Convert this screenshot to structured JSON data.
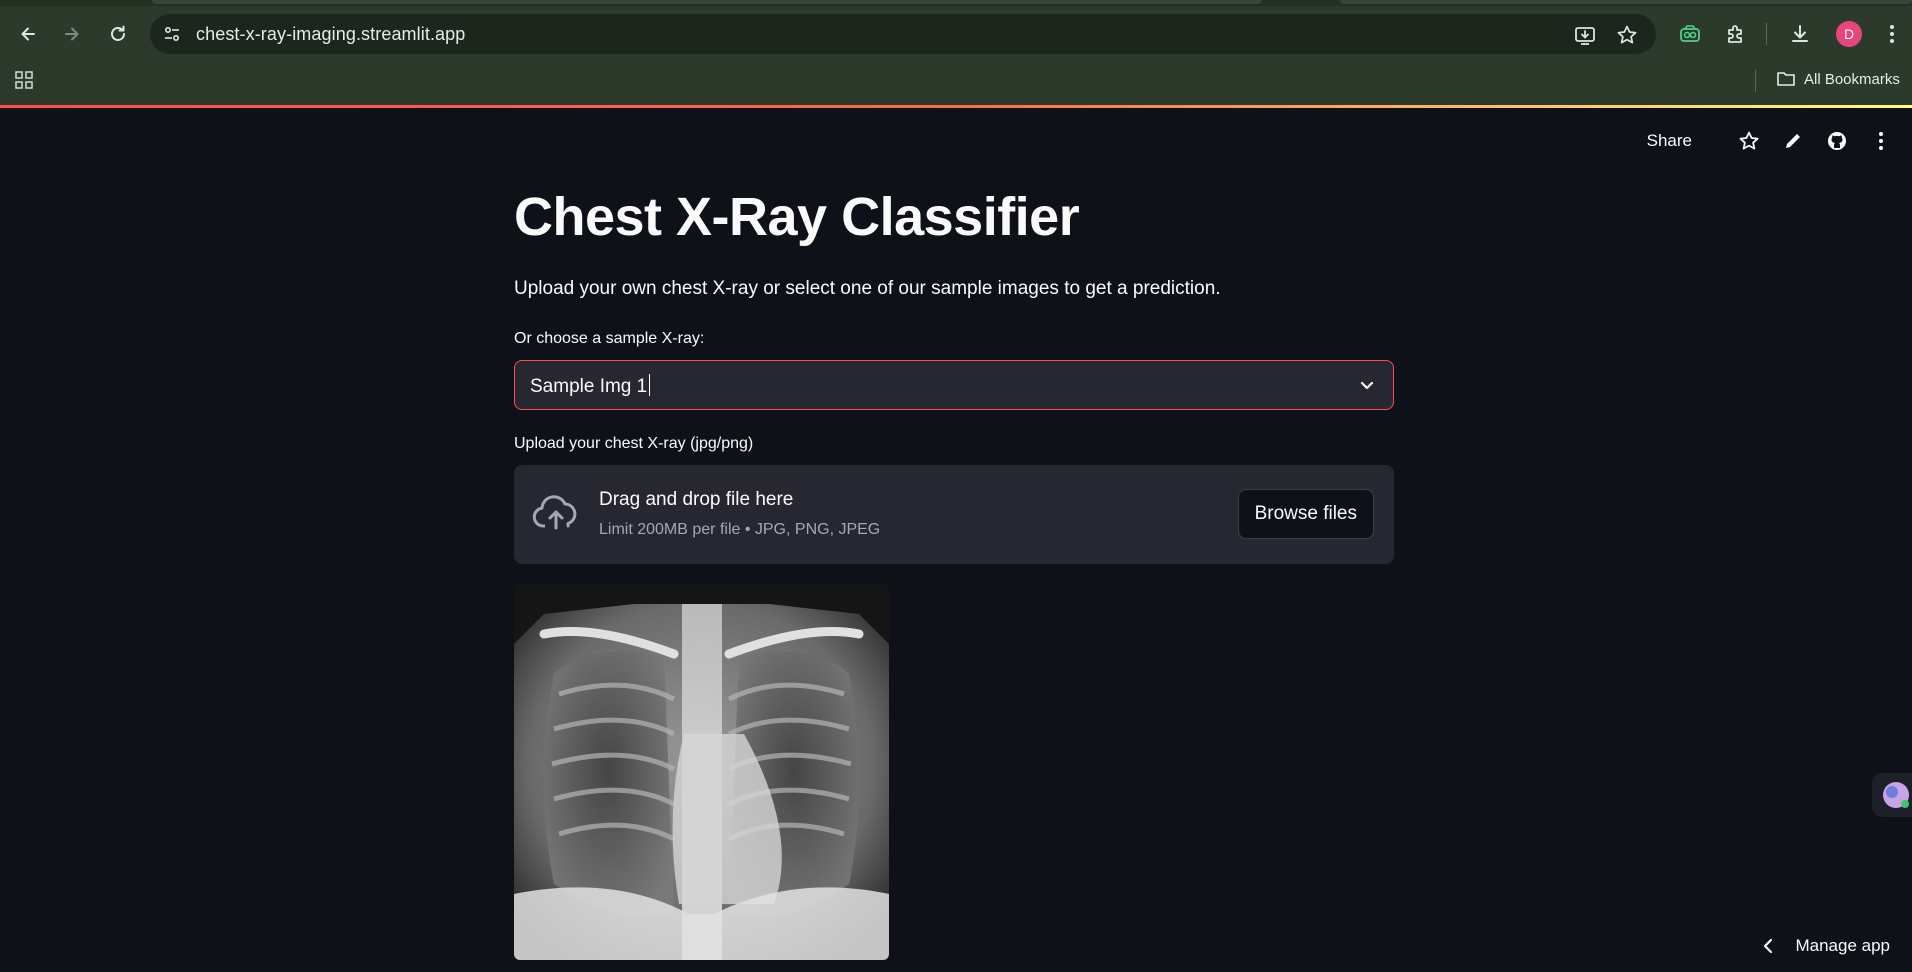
{
  "browser": {
    "url": "chest-x-ray-imaging.streamlit.app",
    "profile_initial": "D",
    "bookmarks_label": "All Bookmarks",
    "icons": [
      "back-icon",
      "forward-icon",
      "reload-icon",
      "site-settings-icon",
      "install-app-icon",
      "bookmark-star-icon",
      "extension-icon",
      "puzzle-icon",
      "download-icon",
      "menu-dots-icon",
      "apps-grid-icon",
      "folder-icon"
    ]
  },
  "app_header": {
    "share_label": "Share",
    "icons": [
      "star-icon",
      "edit-icon",
      "github-icon",
      "more-icon"
    ]
  },
  "main": {
    "title": "Chest X-Ray Classifier",
    "subtitle": "Upload your own chest X-ray or select one of our sample images to get a prediction.",
    "select": {
      "label": "Or choose a sample X-ray:",
      "value": "Sample Img 1"
    },
    "uploader": {
      "label": "Upload your chest X-ray (jpg/png)",
      "drop_title": "Drag and drop file here",
      "drop_subtitle": "Limit 200MB per file • JPG, PNG, JPEG",
      "browse_label": "Browse files"
    }
  },
  "footer": {
    "manage_label": "Manage app"
  },
  "colors": {
    "background": "#0e1117",
    "widget_bg": "#262730",
    "accent": "#ff4b4b",
    "chrome": "#2b3a2b"
  }
}
